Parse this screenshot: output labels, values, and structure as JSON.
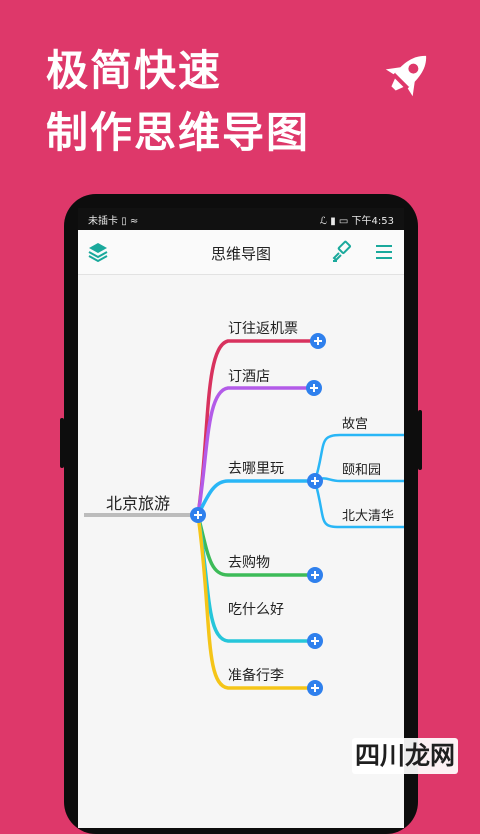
{
  "headline": {
    "line1": "极简快速",
    "line2": "制作思维导图"
  },
  "status_bar": {
    "carrier": "未插卡",
    "time": "下午4:53"
  },
  "toolbar": {
    "title": "思维导图"
  },
  "mindmap": {
    "root": "北京旅游",
    "branches": [
      {
        "label": "订往返机票",
        "color": "#d8325e"
      },
      {
        "label": "订酒店",
        "color": "#b35be8"
      },
      {
        "label": "去哪里玩",
        "color": "#29b6f6"
      },
      {
        "label": "去购物",
        "color": "#3dbb58"
      },
      {
        "label": "吃什么好",
        "color": "#26c6da"
      },
      {
        "label": "准备行李",
        "color": "#f5c518"
      }
    ],
    "sub_branches": [
      "故宫",
      "颐和园",
      "北大清华"
    ],
    "root_line_color": "#bcbcbc",
    "add_button_color": "#2f80ed"
  },
  "watermark": "四川龙网",
  "colors": {
    "background": "#de386a",
    "accent_icon": "#1aa99c"
  }
}
